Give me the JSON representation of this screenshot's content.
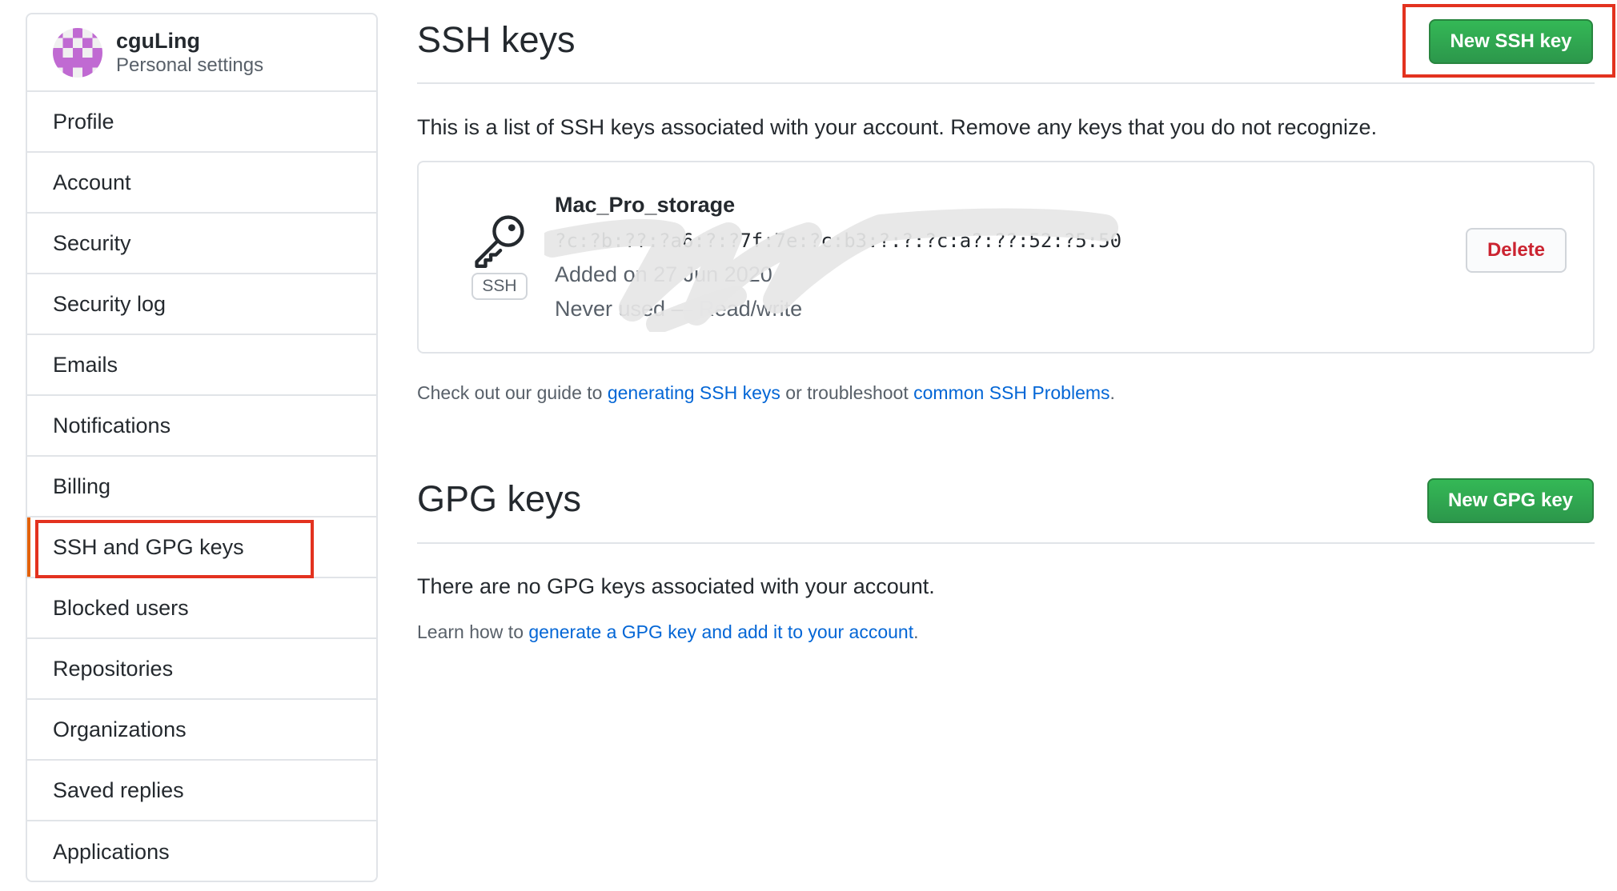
{
  "sidebar": {
    "username": "cguLing",
    "subtitle": "Personal settings",
    "items": [
      {
        "label": "Profile"
      },
      {
        "label": "Account"
      },
      {
        "label": "Security"
      },
      {
        "label": "Security log"
      },
      {
        "label": "Emails"
      },
      {
        "label": "Notifications"
      },
      {
        "label": "Billing"
      },
      {
        "label": "SSH and GPG keys",
        "selected": true
      },
      {
        "label": "Blocked users"
      },
      {
        "label": "Repositories"
      },
      {
        "label": "Organizations"
      },
      {
        "label": "Saved replies"
      },
      {
        "label": "Applications"
      }
    ]
  },
  "ssh": {
    "title": "SSH keys",
    "new_button": "New SSH key",
    "description": "This is a list of SSH keys associated with your account. Remove any keys that you do not recognize.",
    "key": {
      "badge": "SSH",
      "name": "Mac_Pro_storage",
      "fingerprint": "?c:?b:??:?a6:?:?7f:7e:?c:b3:?:?:?c:a?:??:52:?5:50",
      "added": "Added on 27 Jun 2020",
      "usage": "Never used — Read/write",
      "delete_label": "Delete"
    },
    "guide": {
      "prefix": "Check out our guide to ",
      "link1": "generating SSH keys",
      "middle": " or troubleshoot ",
      "link2": "common SSH Problems",
      "suffix": "."
    }
  },
  "gpg": {
    "title": "GPG keys",
    "new_button": "New GPG key",
    "empty_text": "There are no GPG keys associated with your account.",
    "learn": {
      "prefix": "Learn how to ",
      "link": "generate a GPG key and add it to your account",
      "suffix": "."
    }
  },
  "colors": {
    "accent_green": "#2ea44f",
    "link_blue": "#0366d6",
    "danger_red": "#cb2431",
    "annotation_red": "#e3321f",
    "selected_marker": "#e36209"
  }
}
